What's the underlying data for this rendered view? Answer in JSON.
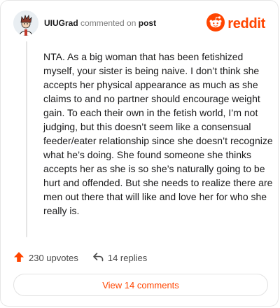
{
  "header": {
    "username": "UIUGrad",
    "action_text": "commented on",
    "post_link": "post",
    "brand": "reddit"
  },
  "comment": {
    "text": "NTA. As a big woman that has been fetishized myself, your sister is being naive. I don’t think she accepts her physical appearance as much as she claims to and no partner should encourage weight gain. To each their own in the fetish world, I’m not judging, but this doesn’t seem like a consensual feeder/eater relationship since she doesn’t recognize what he’s doing. She found someone she thinks accepts her as she is so she’s naturally going to be hurt and offended. But she needs to realize there are men out there that will like and love her for who she really is."
  },
  "actions": {
    "upvotes": "230 upvotes",
    "replies": "14 replies"
  },
  "footer": {
    "view_button": "View 14 comments"
  },
  "colors": {
    "accent": "#ff4500",
    "text": "#1a1a1b",
    "muted": "#7c7c7c"
  },
  "icons": {
    "avatar": "user-avatar",
    "brand": "reddit-logo-icon",
    "upvote": "upvote-arrow-icon",
    "reply": "reply-arrow-icon"
  }
}
